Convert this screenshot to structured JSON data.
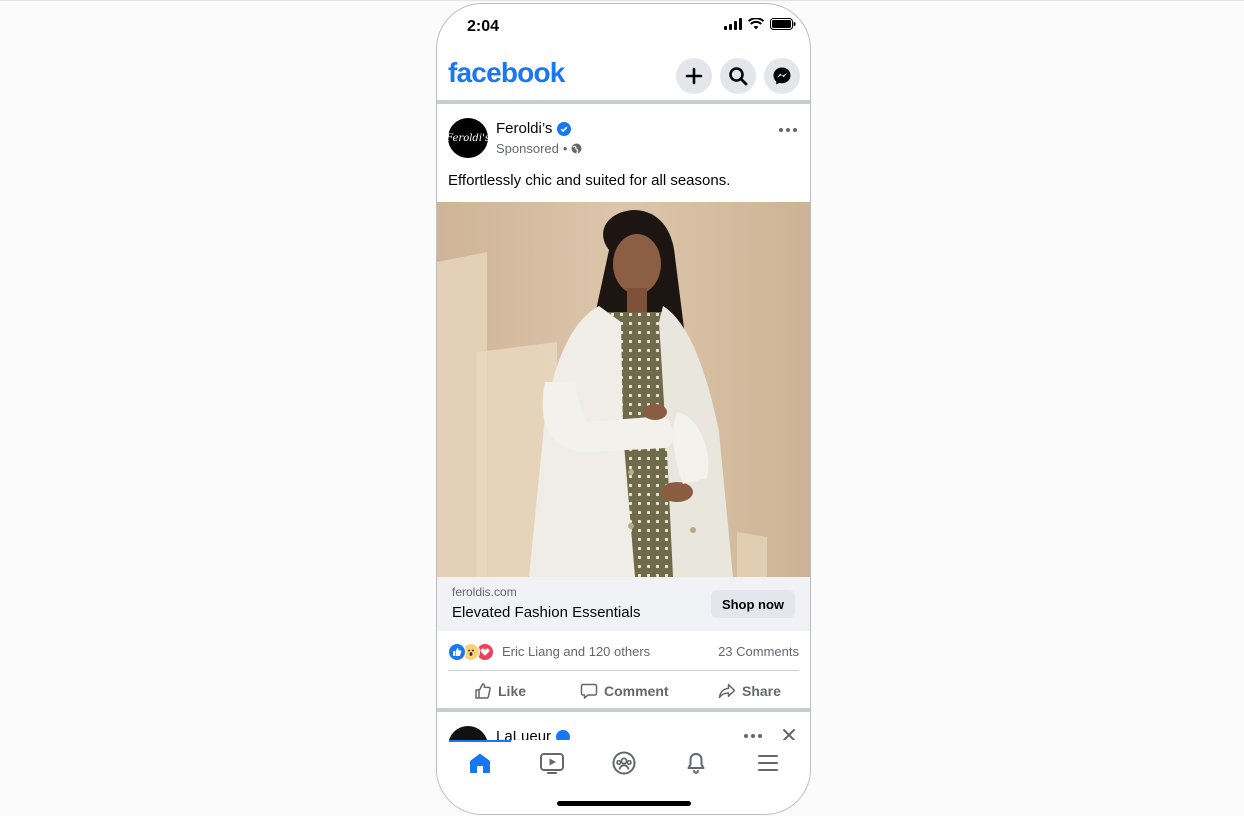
{
  "status_bar": {
    "time": "2:04"
  },
  "header": {
    "logo": "facebook",
    "buttons": [
      "plus-icon",
      "search-icon",
      "messenger-icon"
    ]
  },
  "post": {
    "avatar_text": "Feroldi's",
    "page_name": "Feroldi’s",
    "sponsored": "Sponsored",
    "separator": "•",
    "caption": "Effortlessly chic and suited for all seasons.",
    "link": {
      "domain": "feroldis.com",
      "title": "Elevated Fashion Essentials",
      "cta": "Shop now"
    },
    "reactions_text": "Eric Liang and 120 others",
    "comments_text": "23 Comments",
    "actions": {
      "like": "Like",
      "comment": "Comment",
      "share": "Share"
    }
  },
  "next_post": {
    "page_name": "LaLueur"
  },
  "bottom_nav": [
    "home-icon",
    "video-icon",
    "groups-icon",
    "bell-icon",
    "menu-icon"
  ],
  "colors": {
    "brand": "#1877f2",
    "secondary_text": "#65676b",
    "button_bg": "#e4e6eb"
  }
}
